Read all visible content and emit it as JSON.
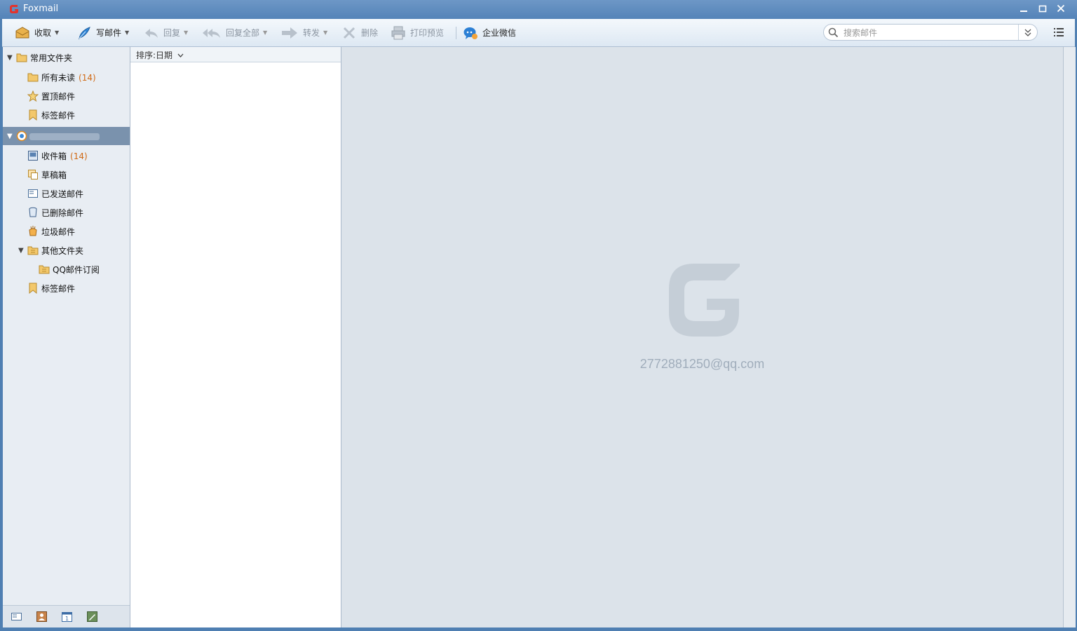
{
  "app": {
    "title": "Foxmail"
  },
  "toolbar": {
    "receive": "收取",
    "compose": "写邮件",
    "reply": "回复",
    "reply_all": "回复全部",
    "forward": "转发",
    "delete": "删除",
    "print_preview": "打印预览",
    "wecom": "企业微信",
    "search_placeholder": "搜索邮件"
  },
  "sidebar": {
    "common_group": "常用文件夹",
    "common_items": [
      {
        "label": "所有未读",
        "count": "(14)"
      },
      {
        "label": "置顶邮件"
      },
      {
        "label": "标签邮件"
      }
    ],
    "account_items": [
      {
        "label": "收件箱",
        "count": "(14)"
      },
      {
        "label": "草稿箱"
      },
      {
        "label": "已发送邮件"
      },
      {
        "label": "已删除邮件"
      },
      {
        "label": "垃圾邮件"
      },
      {
        "label": "其他文件夹"
      },
      {
        "label": "QQ邮件订阅"
      },
      {
        "label": "标签邮件"
      }
    ]
  },
  "list": {
    "sort_label": "排序:日期"
  },
  "reader": {
    "account_email": "2772881250@qq.com"
  }
}
